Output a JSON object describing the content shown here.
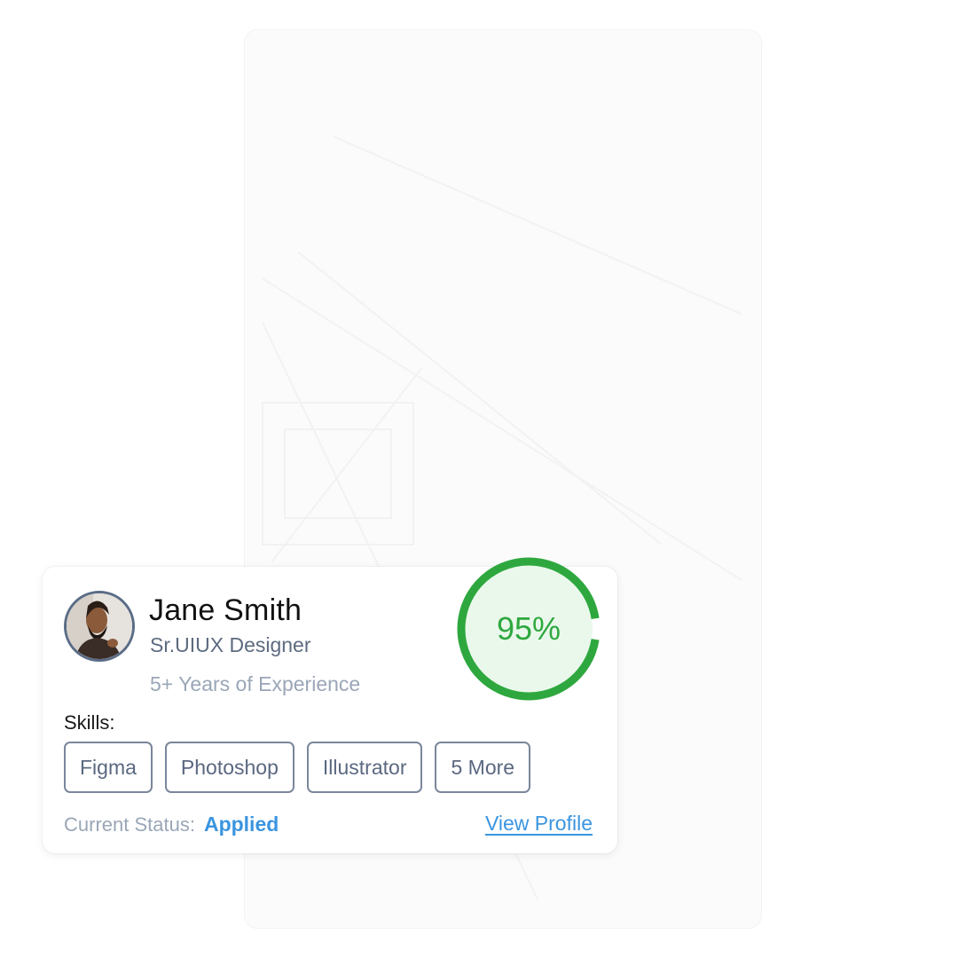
{
  "candidate": {
    "name": "Jane Smith",
    "role": "Sr.UIUX Designer",
    "experience": "5+ Years of Experience",
    "avatar_icon": "person-photo",
    "match_score_label": "95%",
    "match_score_fraction": 0.95
  },
  "skills": {
    "label": "Skills:",
    "items": [
      "Figma",
      "Photoshop",
      "Illustrator",
      "5 More"
    ]
  },
  "status": {
    "label": "Current Status:",
    "value": "Applied"
  },
  "actions": {
    "view_profile": "View Profile"
  },
  "colors": {
    "accent_blue": "#3b95e0",
    "score_green": "#2ea83e",
    "score_fill": "#eaf8ec",
    "chip_border": "#7a869b"
  }
}
